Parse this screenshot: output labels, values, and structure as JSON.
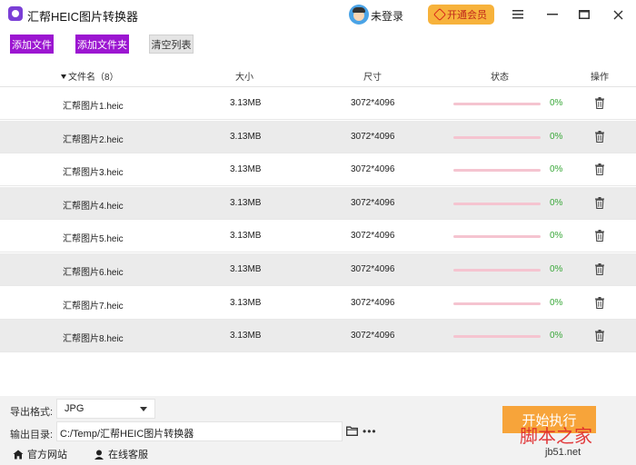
{
  "app": {
    "title": "汇帮HEIC图片转换器"
  },
  "user": {
    "login_label": "未登录"
  },
  "vip": {
    "label": "开通会员"
  },
  "toolbar": {
    "add_files": "添加文件",
    "add_folder": "添加文件夹",
    "clear_list": "清空列表"
  },
  "table": {
    "headers": {
      "name": "文件名（8）",
      "size": "大小",
      "dims": "尺寸",
      "status": "状态",
      "action": "操作"
    },
    "rows": [
      {
        "name": "汇帮图片1.heic",
        "size": "3.13MB",
        "dims": "3072*4096",
        "progress": "0%"
      },
      {
        "name": "汇帮图片2.heic",
        "size": "3.13MB",
        "dims": "3072*4096",
        "progress": "0%"
      },
      {
        "name": "汇帮图片3.heic",
        "size": "3.13MB",
        "dims": "3072*4096",
        "progress": "0%"
      },
      {
        "name": "汇帮图片4.heic",
        "size": "3.13MB",
        "dims": "3072*4096",
        "progress": "0%"
      },
      {
        "name": "汇帮图片5.heic",
        "size": "3.13MB",
        "dims": "3072*4096",
        "progress": "0%"
      },
      {
        "name": "汇帮图片6.heic",
        "size": "3.13MB",
        "dims": "3072*4096",
        "progress": "0%"
      },
      {
        "name": "汇帮图片7.heic",
        "size": "3.13MB",
        "dims": "3072*4096",
        "progress": "0%"
      },
      {
        "name": "汇帮图片8.heic",
        "size": "3.13MB",
        "dims": "3072*4096",
        "progress": "0%"
      }
    ]
  },
  "output": {
    "format_label": "导出格式:",
    "format_value": "JPG",
    "dir_label": "输出目录:",
    "dir_value": "C:/Temp/汇帮HEIC图片转换器"
  },
  "start_button": "开始执行",
  "footer": {
    "website": "官方网站",
    "support": "在线客服"
  },
  "watermark": {
    "text": "脚本之家",
    "sub": "jb51.net"
  },
  "colors": {
    "accent": "#9c16d1",
    "start": "#f7a43a",
    "vip": "#f7b23b",
    "progress_track": "#f5c4d0",
    "percent": "#3aa83a"
  }
}
